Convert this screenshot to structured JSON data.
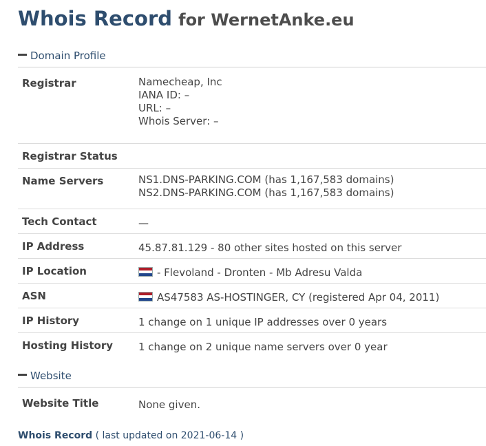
{
  "header": {
    "title": "Whois Record",
    "subtitle": "for WernetAnke.eu"
  },
  "sections": {
    "domain_profile": {
      "label": "Domain Profile",
      "rows": {
        "registrar": {
          "key": "Registrar",
          "lines": [
            "Namecheap, Inc",
            "IANA ID: –",
            "URL: –",
            "Whois Server: –"
          ]
        },
        "registrar_status": {
          "key": "Registrar Status",
          "value": ""
        },
        "name_servers": {
          "key": "Name Servers",
          "lines": [
            "NS1.DNS-PARKING.COM (has 1,167,583 domains)",
            "NS2.DNS-PARKING.COM (has 1,167,583 domains)"
          ]
        },
        "tech_contact": {
          "key": "Tech Contact",
          "value": "—"
        },
        "ip_address": {
          "key": "IP Address",
          "value": "45.87.81.129 - 80 other sites hosted on this server"
        },
        "ip_location": {
          "key": "IP Location",
          "value": "- Flevoland - Dronten - Mb Adresu Valda",
          "flag_icon": "netherlands-flag-icon"
        },
        "asn": {
          "key": "ASN",
          "value": "AS47583 AS-HOSTINGER, CY (registered Apr 04, 2011)",
          "flag_icon": "netherlands-flag-icon"
        },
        "ip_history": {
          "key": "IP History",
          "value": "1 change on 1 unique IP addresses over 0 years"
        },
        "hosting_history": {
          "key": "Hosting History",
          "value": "1 change on 2 unique name servers over 0 year"
        }
      }
    },
    "website": {
      "label": "Website",
      "rows": {
        "website_title": {
          "key": "Website Title",
          "value": "None given."
        }
      }
    }
  },
  "footer": {
    "link_label": "Whois Record",
    "updated_text": "( last updated on 2021-06-14 )"
  },
  "colors": {
    "heading": "#2e4d6e",
    "text": "#444444",
    "divider": "#dcdcdc"
  }
}
